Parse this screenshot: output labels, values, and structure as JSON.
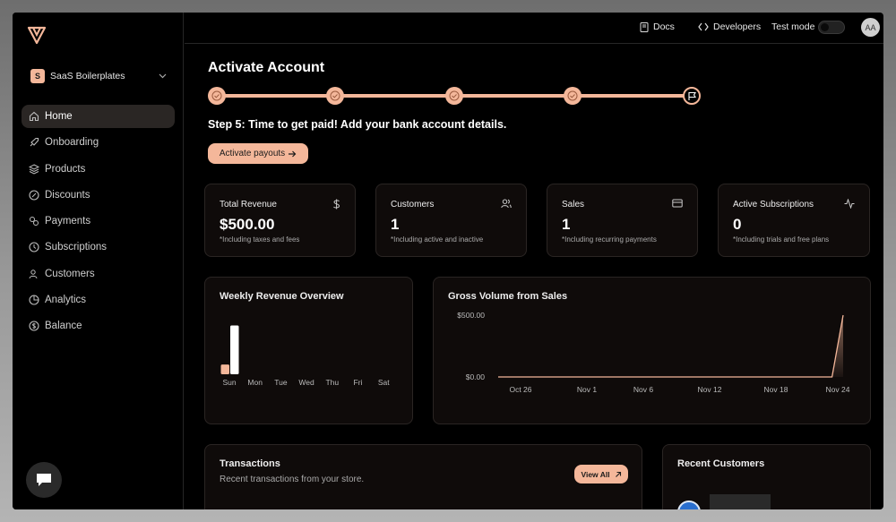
{
  "sidebar": {
    "org": {
      "badge": "S",
      "name": "SaaS Boilerplates"
    },
    "items": [
      {
        "label": "Home",
        "icon": "home-icon",
        "active": true
      },
      {
        "label": "Onboarding",
        "icon": "rocket-icon"
      },
      {
        "label": "Products",
        "icon": "layers-icon"
      },
      {
        "label": "Discounts",
        "icon": "badge-percent-icon"
      },
      {
        "label": "Payments",
        "icon": "payments-icon"
      },
      {
        "label": "Subscriptions",
        "icon": "clock-icon"
      },
      {
        "label": "Customers",
        "icon": "users-icon"
      },
      {
        "label": "Analytics",
        "icon": "pie-chart-icon"
      },
      {
        "label": "Balance",
        "icon": "dollar-circle-icon"
      }
    ]
  },
  "topbar": {
    "docs": "Docs",
    "developers": "Developers",
    "test_mode": "Test mode",
    "avatar": "AA"
  },
  "main": {
    "title": "Activate Account",
    "step_text": "Step 5: Time to get paid! Add your bank account details.",
    "activate_button": "Activate payouts",
    "stats": [
      {
        "title": "Total Revenue",
        "value": "$500.00",
        "sub": "*Including taxes and fees",
        "icon": "dollar-icon"
      },
      {
        "title": "Customers",
        "value": "1",
        "sub": "*Including active and inactive",
        "icon": "users-icon"
      },
      {
        "title": "Sales",
        "value": "1",
        "sub": "*Including recurring payments",
        "icon": "credit-card-icon"
      },
      {
        "title": "Active Subscriptions",
        "value": "0",
        "sub": "*Including trials and free plans",
        "icon": "activity-icon"
      }
    ],
    "weekly_title": "Weekly Revenue Overview",
    "gross_title": "Gross Volume from Sales",
    "transactions": {
      "title": "Transactions",
      "subtitle": "Recent transactions from your store.",
      "view_all": "View All"
    },
    "recent_customers": {
      "title": "Recent Customers"
    }
  },
  "chart_data": [
    {
      "type": "bar",
      "title": "Weekly Revenue Overview",
      "categories": [
        "Sun",
        "Mon",
        "Tue",
        "Wed",
        "Thu",
        "Fri",
        "Sat"
      ],
      "series": [
        {
          "values": [
            1,
            0,
            0,
            0,
            0,
            0,
            0
          ],
          "color": "#f4b79a"
        },
        {
          "values": [
            5,
            0,
            0,
            0,
            0,
            0,
            0
          ],
          "color": "#ffffff"
        }
      ],
      "ylim": [
        0,
        5.5
      ]
    },
    {
      "type": "area",
      "title": "Gross Volume from Sales",
      "x": [
        "Oct 26",
        "Nov 1",
        "Nov 6",
        "Nov 12",
        "Nov 18",
        "Nov 24"
      ],
      "values": [
        0,
        0,
        0,
        0,
        0,
        0,
        0,
        0,
        0,
        0,
        0,
        0,
        0,
        0,
        0,
        0,
        0,
        0,
        0,
        0,
        0,
        0,
        0,
        0,
        0,
        0,
        0,
        0,
        0,
        0,
        0,
        500
      ],
      "y_ticks": [
        "$500.00",
        "$0.00"
      ],
      "ylim": [
        0,
        500
      ],
      "color": "#f4b79a"
    }
  ]
}
